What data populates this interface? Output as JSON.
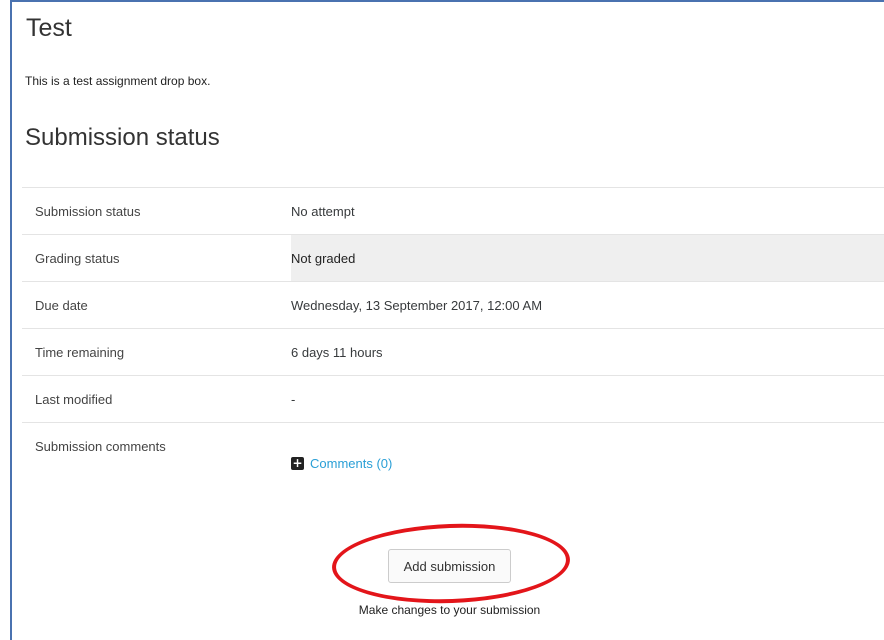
{
  "page": {
    "title": "Test",
    "intro": "This is a test assignment drop box."
  },
  "submission_status": {
    "heading": "Submission status",
    "rows": [
      {
        "label": "Submission status",
        "value": "No attempt"
      },
      {
        "label": "Grading status",
        "value": "Not graded"
      },
      {
        "label": "Due date",
        "value": "Wednesday, 13 September 2017, 12:00 AM"
      },
      {
        "label": "Time remaining",
        "value": "6 days 11 hours"
      },
      {
        "label": "Last modified",
        "value": "-"
      },
      {
        "label": "Submission comments",
        "comments_link": "Comments (0)",
        "icon": "plus-square-icon"
      }
    ]
  },
  "actions": {
    "add_submission_label": "Add submission",
    "add_submission_help": "Make changes to your submission",
    "highlight_color": "#e3151a"
  }
}
